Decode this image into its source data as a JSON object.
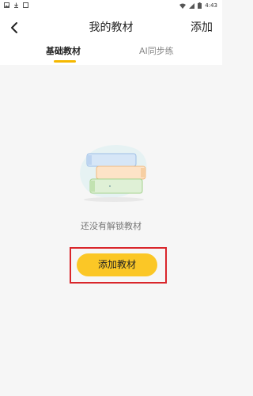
{
  "status_bar": {
    "time": "4:43",
    "icons": [
      "image-icon",
      "download-icon",
      "square-icon",
      "wifi-icon",
      "signal-icon",
      "battery-icon"
    ]
  },
  "header": {
    "title": "我的教材",
    "add_label": "添加",
    "back_icon": "chevron-left-icon"
  },
  "tabs": [
    {
      "label": "基础教材",
      "active": true
    },
    {
      "label": "AI同步练",
      "active": false
    }
  ],
  "empty_state": {
    "message": "还没有解锁教材",
    "button_label": "添加教材",
    "illustration": "stacked-books-illustration"
  },
  "colors": {
    "accent": "#fbc726",
    "tab_underline": "#f5b800",
    "highlight": "#d9262b",
    "background": "#f6f6f6"
  }
}
